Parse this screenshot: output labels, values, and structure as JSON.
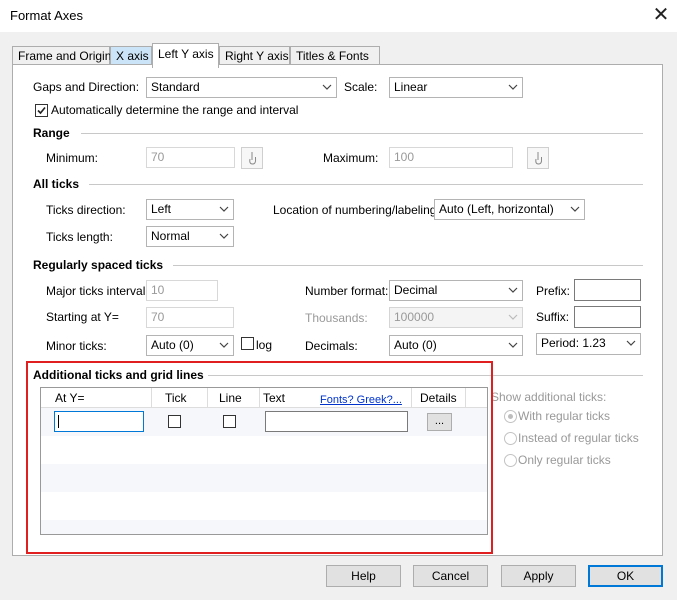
{
  "window": {
    "title": "Format Axes",
    "close_glyph": "✕"
  },
  "tabs": [
    "Frame and Origin",
    "X axis",
    "Left Y axis",
    "Right Y axis",
    "Titles & Fonts"
  ],
  "top": {
    "gaps_label": "Gaps and Direction:",
    "gaps_value": "Standard",
    "scale_label": "Scale:",
    "scale_value": "Linear",
    "auto_range_label": "Automatically determine the range and interval",
    "auto_range_checked": true
  },
  "range": {
    "heading": "Range",
    "min_label": "Minimum:",
    "min_value": "70",
    "max_label": "Maximum:",
    "max_value": "100"
  },
  "all_ticks": {
    "heading": "All ticks",
    "direction_label": "Ticks direction:",
    "direction_value": "Left",
    "location_label": "Location of numbering/labeling:",
    "location_value": "Auto (Left, horizontal)",
    "length_label": "Ticks length:",
    "length_value": "Normal"
  },
  "regular": {
    "heading": "Regularly spaced ticks",
    "major_label": "Major ticks interval:",
    "major_value": "10",
    "start_label": "Starting at Y=",
    "start_value": "70",
    "minor_label": "Minor ticks:",
    "minor_value": "Auto (0)",
    "log_label": "log",
    "numformat_label": "Number format:",
    "numformat_value": "Decimal",
    "thousands_label": "Thousands:",
    "thousands_value": "100000",
    "decimals_label": "Decimals:",
    "decimals_value": "Auto (0)",
    "prefix_label": "Prefix:",
    "prefix_value": "",
    "suffix_label": "Suffix:",
    "suffix_value": "",
    "period_value": "Period: 1.23"
  },
  "additional": {
    "heading": "Additional ticks and grid lines",
    "columns": {
      "at_y": "At Y=",
      "tick": "Tick",
      "line": "Line",
      "text": "Text",
      "fonts_link": "Fonts? Greek?...",
      "details": "Details"
    },
    "details_button": "...",
    "show_label": "Show additional ticks:",
    "options": [
      "With regular ticks",
      "Instead of regular ticks",
      "Only regular ticks"
    ],
    "selected_option": "With regular ticks"
  },
  "buttons": {
    "help": "Help",
    "cancel": "Cancel",
    "apply": "Apply",
    "ok": "OK"
  },
  "colors": {
    "highlight_frame": "#e02020",
    "selected_tab": "#cce4f7",
    "default_button_border": "#0078d7"
  }
}
